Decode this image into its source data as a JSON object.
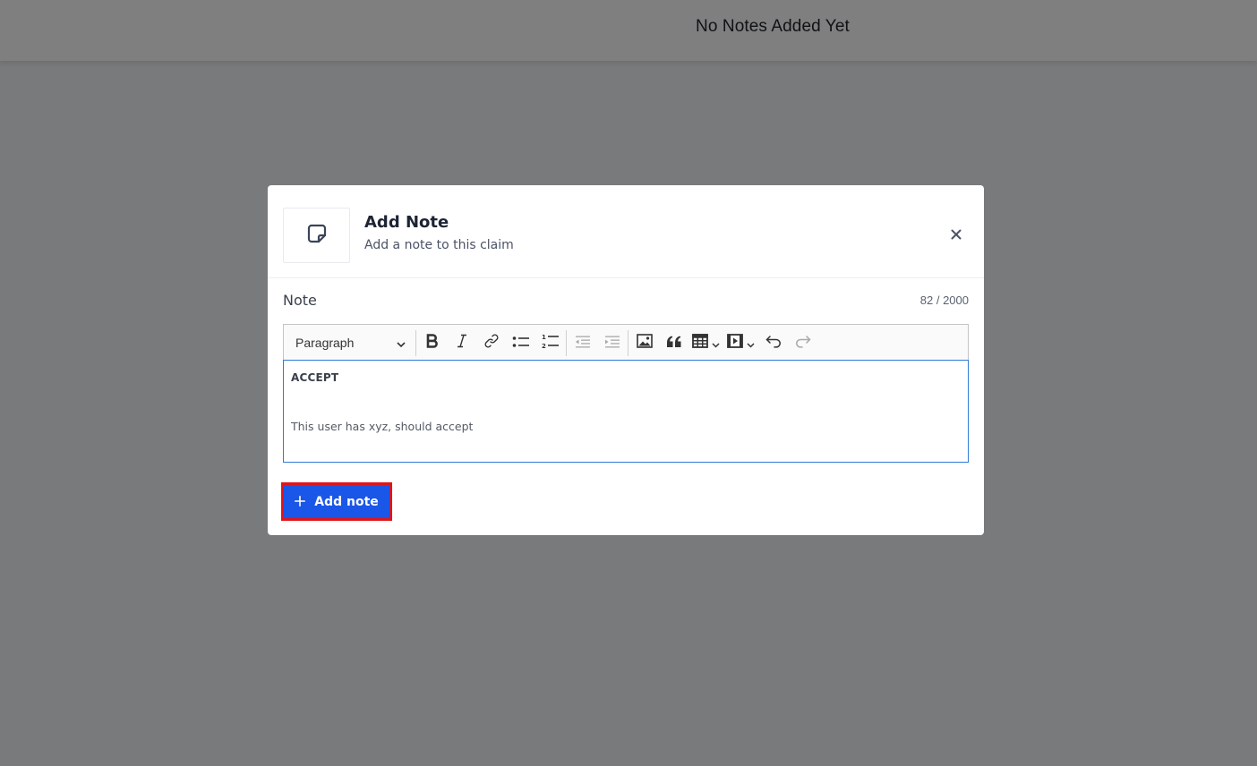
{
  "page": {
    "empty_state_title": "No Notes Added Yet"
  },
  "modal": {
    "icon": "sticky-note-icon",
    "title": "Add Note",
    "subtitle": "Add a note to this claim",
    "close_icon": "close-icon"
  },
  "field": {
    "label": "Note",
    "char_count": "82 / 2000"
  },
  "toolbar": {
    "block_format": "Paragraph",
    "buttons": [
      {
        "name": "bold",
        "icon": "bold-icon"
      },
      {
        "name": "italic",
        "icon": "italic-icon"
      },
      {
        "name": "link",
        "icon": "link-icon"
      },
      {
        "name": "bulleted-list",
        "icon": "bulleted-list-icon"
      },
      {
        "name": "numbered-list",
        "icon": "numbered-list-icon"
      },
      {
        "name": "outdent",
        "icon": "outdent-icon"
      },
      {
        "name": "indent",
        "icon": "indent-icon"
      },
      {
        "name": "image",
        "icon": "image-icon"
      },
      {
        "name": "block-quote",
        "icon": "quote-icon"
      },
      {
        "name": "table",
        "icon": "table-icon"
      },
      {
        "name": "media",
        "icon": "media-icon"
      },
      {
        "name": "undo",
        "icon": "undo-icon"
      },
      {
        "name": "redo",
        "icon": "redo-icon"
      }
    ]
  },
  "editor": {
    "lines": [
      {
        "text": "ACCEPT",
        "style": "bold"
      },
      {
        "text": "",
        "style": "empty"
      },
      {
        "text": "This user has xyz, should accept",
        "style": "normal"
      }
    ]
  },
  "actions": {
    "add_note_label": "Add note",
    "add_note_icon": "plus-icon"
  },
  "colors": {
    "primary": "#1a56e8",
    "highlight_border": "#e0151b",
    "editor_focus_border": "#2f7bd8"
  }
}
